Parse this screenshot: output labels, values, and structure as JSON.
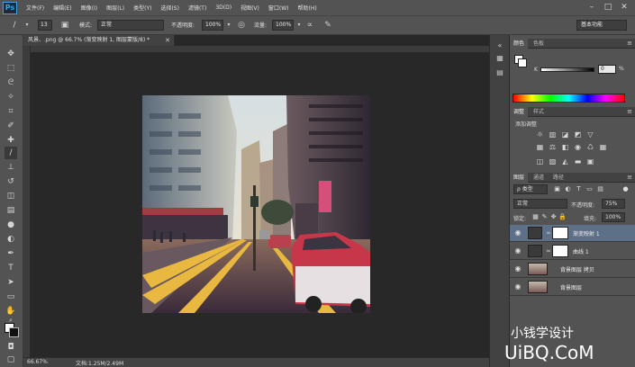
{
  "app": {
    "logo": "Ps"
  },
  "menu": [
    "文件(F)",
    "编辑(E)",
    "图像(I)",
    "图层(L)",
    "类型(Y)",
    "选择(S)",
    "滤镜(T)",
    "3D(D)",
    "视图(V)",
    "窗口(W)",
    "帮助(H)"
  ],
  "window_controls": {
    "minimize": "–",
    "maximize": "□",
    "close": "✕"
  },
  "options": {
    "brush_size": "13",
    "mode_label": "模式:",
    "mode_value": "正常",
    "opacity_label": "不透明度:",
    "opacity_value": "100%",
    "flow_label": "流量:",
    "flow_value": "100%",
    "workspace": "基本功能"
  },
  "document": {
    "tab_title": "风景、.png @ 66.7% (渐变映射 1, 图层蒙版/8) *",
    "zoom": "66.67%",
    "doc_size": "文档:1.25M/2.49M"
  },
  "color_panel": {
    "tabs": [
      "颜色",
      "色板"
    ],
    "k_label": "K",
    "k_value": "0",
    "k_unit": "%"
  },
  "adjustments_panel": {
    "tabs": [
      "调整",
      "样式"
    ],
    "title": "添加调整"
  },
  "layers_panel": {
    "tabs": [
      "图层",
      "通道",
      "路径"
    ],
    "filter_label": "ρ 类型",
    "blend_mode": "正常",
    "opacity_label": "不透明度:",
    "opacity_value": "75%",
    "lock_label": "锁定:",
    "fill_label": "填充:",
    "fill_value": "100%",
    "layers": [
      {
        "name": "渐变映射 1",
        "selected": true
      },
      {
        "name": "曲线 1",
        "selected": false
      },
      {
        "name": "背景图层 拷贝",
        "selected": false
      },
      {
        "name": "背景图层",
        "selected": false
      }
    ]
  },
  "watermark": {
    "line1": "小钱学设计",
    "line2": "UiBQ.CoM"
  }
}
